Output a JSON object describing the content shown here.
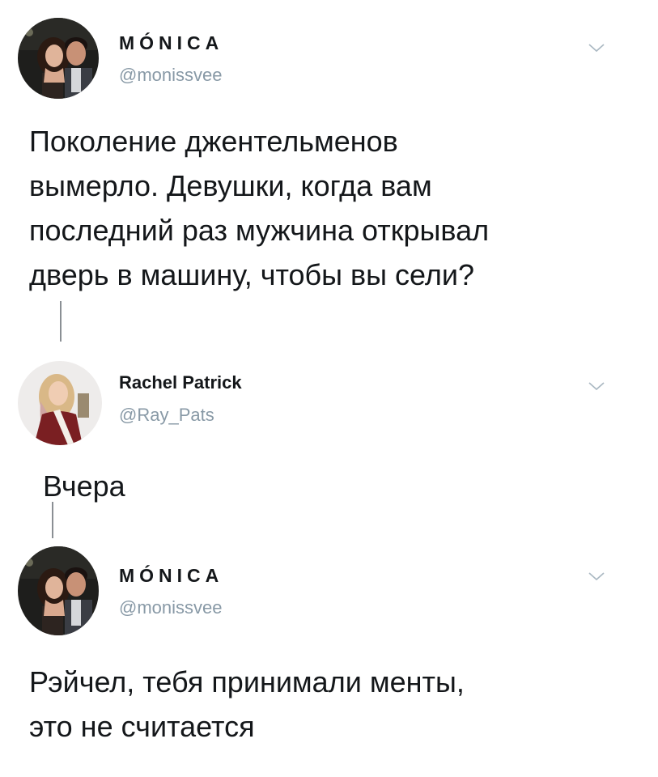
{
  "tweets": [
    {
      "name": "MÓNICA",
      "handle": "@monissvee",
      "avatar_icon": "profile-photo-couple",
      "chevron_icon": "chevron-down-icon",
      "text": "Поколение джентельменов\nвымерло. Девушки, когда вам\nпоследний раз мужчина открывал\nдверь в машину, чтобы вы сели?"
    },
    {
      "name": "Rachel Patrick",
      "handle": "@Ray_Pats",
      "avatar_icon": "profile-photo-woman",
      "chevron_icon": "chevron-down-icon",
      "text": "Вчера"
    },
    {
      "name": "MÓNICA",
      "handle": "@monissvee",
      "avatar_icon": "profile-photo-couple",
      "chevron_icon": "chevron-down-icon",
      "text": "Рэйчел, тебя принимали менты,\nэто не считается"
    }
  ],
  "colors": {
    "text": "#14171a",
    "handle": "#8899a6",
    "thread_line": "#8a8f94",
    "chevron": "#aab8c2"
  }
}
